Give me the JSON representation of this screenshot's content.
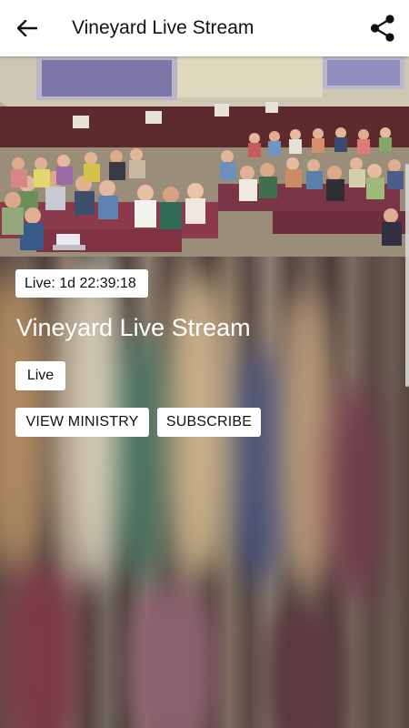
{
  "app_bar": {
    "title": "Vineyard Live Stream",
    "back_icon": "arrow-left-icon",
    "share_icon": "share-icon"
  },
  "hero": {
    "image": "church-congregation-photo"
  },
  "stream": {
    "live_timer": "Live: 1d 22:39:18",
    "title": "Vineyard Live Stream",
    "status_badge": "Live"
  },
  "actions": {
    "view_ministry_label": "VIEW MINISTRY",
    "subscribe_label": "SUBSCRIBE"
  },
  "colors": {
    "app_bar_bg": "#ffffff",
    "text_dark": "#111111",
    "overlay_text": "#ffffff"
  }
}
